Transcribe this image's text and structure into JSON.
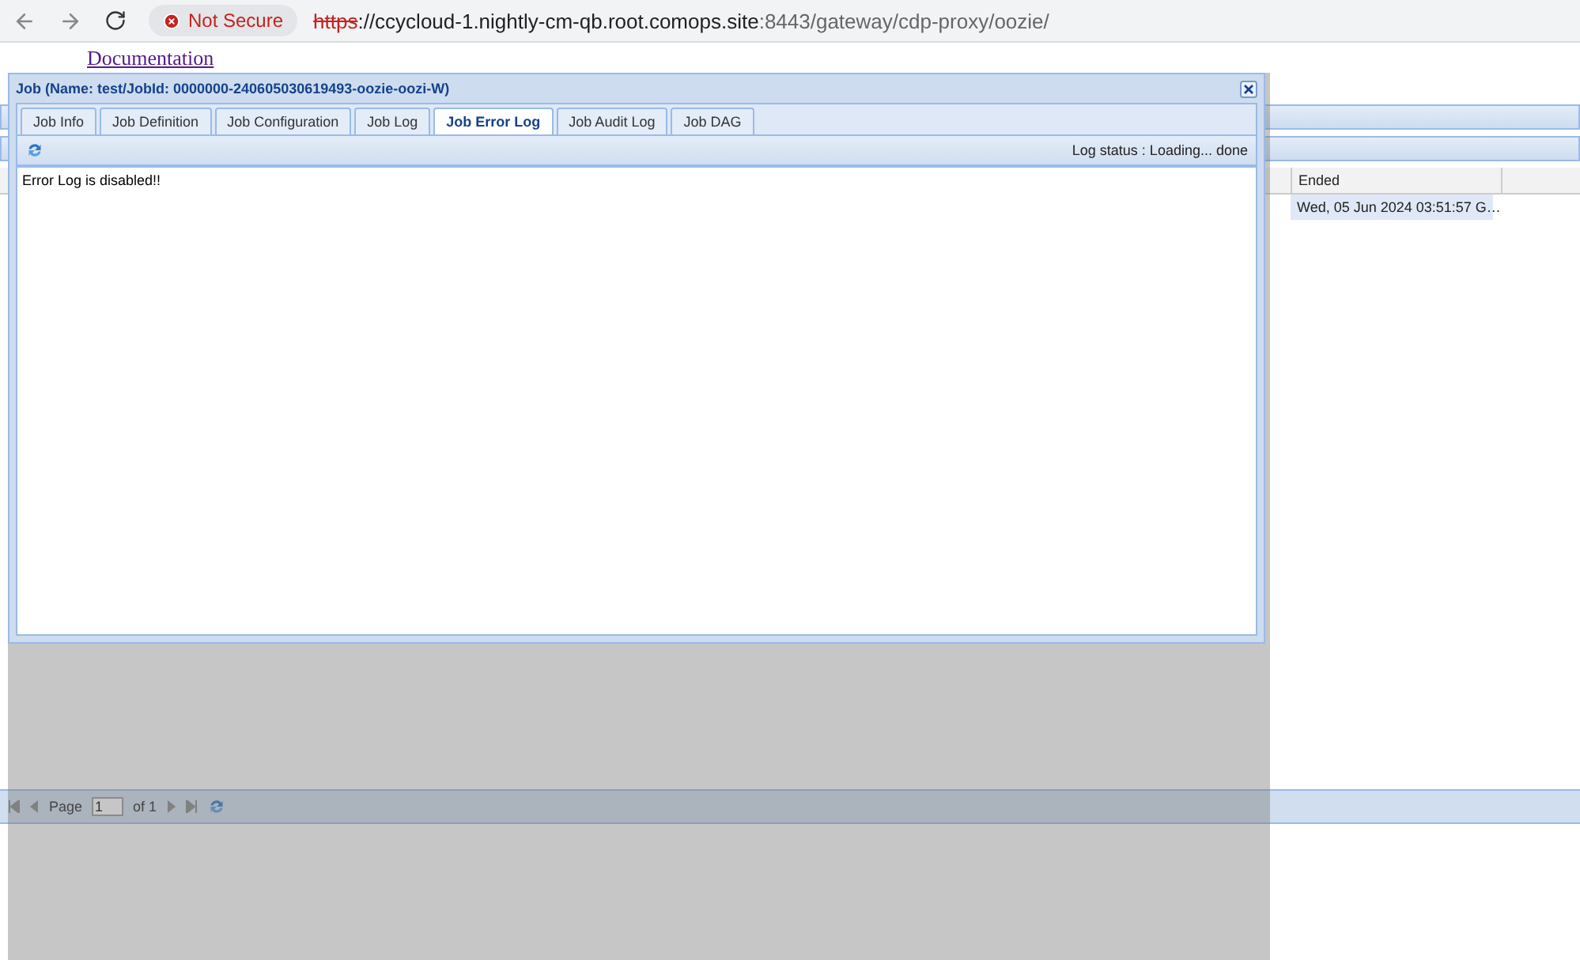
{
  "browser": {
    "security_label": "Not Secure",
    "url_scheme": "https",
    "url_rest": "://ccycloud-1.nightly-cm-qb.root.comops.site",
    "url_path": ":8443/gateway/cdp-proxy/oozie/"
  },
  "page": {
    "header_link": "Documentation",
    "grid": {
      "columns": [
        {
          "label": "Ended"
        }
      ],
      "rows": [
        {
          "cells": [
            "Wed, 05 Jun 2024 03:51:57 G…"
          ]
        }
      ]
    },
    "pager": {
      "page_label": "Page",
      "page_value": "1",
      "of_label": "of 1"
    }
  },
  "dialog": {
    "title": "Job (Name: test/JobId: 0000000-240605030619493-oozie-oozi-W)",
    "tabs": [
      {
        "label": "Job Info",
        "selected": false
      },
      {
        "label": "Job Definition",
        "selected": false
      },
      {
        "label": "Job Configuration",
        "selected": false
      },
      {
        "label": "Job Log",
        "selected": false
      },
      {
        "label": "Job Error Log",
        "selected": true
      },
      {
        "label": "Job Audit Log",
        "selected": false
      },
      {
        "label": "Job DAG",
        "selected": false
      }
    ],
    "log_status": "Log status : Loading... done",
    "content": "Error Log is disabled!!"
  }
}
